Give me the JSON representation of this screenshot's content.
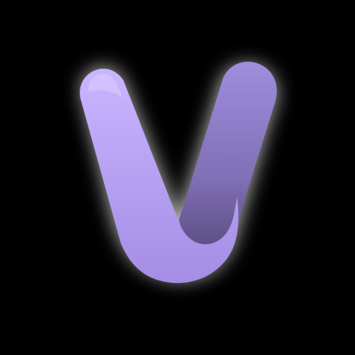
{
  "icon": {
    "name": "V",
    "shape": "rounded-v-logo",
    "background_color": "#000000",
    "glow_color": "#ffffff",
    "left_stroke_colors": [
      "#c9b5ff",
      "#a48de4"
    ],
    "right_stroke_colors": [
      "#9f8ddd",
      "#8a78c4",
      "#5c4d86"
    ]
  }
}
